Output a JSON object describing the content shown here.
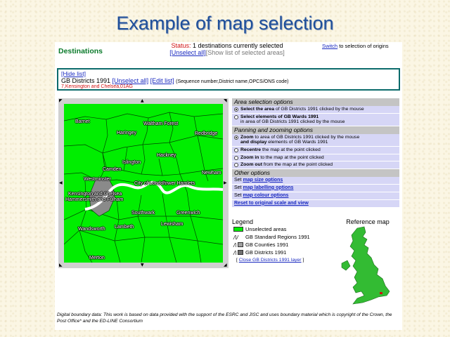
{
  "slide": {
    "title": "Example of map selection"
  },
  "header": {
    "destinations_label": "Destinations",
    "status_label": "Status:",
    "status_text": "1 destinations currently selected",
    "unselect_all": "[Unselect all]",
    "show_list": "[Show list of selected areas]",
    "switch_link": "Switch",
    "switch_text": "to selection of origins"
  },
  "selection": {
    "hide_list": "[Hide list]",
    "layer_name": "GB Districts 1991",
    "unselect_all": "[Unselect all]",
    "edit_list": "[Edit list]",
    "format_hint": "(Sequence number,District name,OPCS/ONS code)",
    "selected_item": "7,Kensington and Chelsea,01AG"
  },
  "map": {
    "labels": [
      "Barnet",
      "Waltham Forest",
      "Haringey",
      "Redbridge",
      "Hackney",
      "Islington",
      "Camden",
      "Newham",
      "Westminster",
      "Tower Hamlets",
      "City of London",
      "Kensington and Chelsea",
      "Hammersmith and Fulham",
      "Southwark",
      "Greenwich",
      "Wandsworth",
      "Lambeth",
      "Lewisham",
      "Merton"
    ],
    "colors": {
      "land": "#00ee00",
      "selected": "#8a8a8a",
      "river": "#ffffff"
    }
  },
  "options": {
    "area_header": "Area selection options",
    "area_opt1_a": "Select the area",
    "area_opt1_b": "of GB Districts 1991 clicked by the mouse",
    "area_opt2_a": "Select elements of GB Wards 1991",
    "area_opt2_b": "in area of GB Districts 1991 clicked by the mouse",
    "pan_header": "Panning and zooming options",
    "pan_opt1_a": "Zoom",
    "pan_opt1_b": "to area of GB Districts 1991 clicked by the mouse",
    "pan_opt1_c": "and display",
    "pan_opt1_d": "elements of GB Wards 1991",
    "pan_opt2_a": "Recentre",
    "pan_opt2_b": "the map at the point clicked",
    "pan_opt3_a": "Zoom in",
    "pan_opt3_b": "to the map at the point clicked",
    "pan_opt4_a": "Zoom out",
    "pan_opt4_b": "from the map at the point clicked",
    "other_header": "Other options",
    "set_label": "Set",
    "map_size": "map size options",
    "map_labelling": "map labelling options",
    "map_colour": "map colour options",
    "reset": "Reset to original scale and view"
  },
  "legend": {
    "title": "Legend",
    "unselected": "Unselected areas",
    "regions": "GB Standard Regions 1991",
    "counties": "GB Counties 1991",
    "districts": "GB Districts 1991",
    "close_layer": "Close GB Districts 1991 layer",
    "colors": {
      "unselected": "#00ee00",
      "counties": "#a0a0a0",
      "districts": "#707070"
    }
  },
  "reference_map": {
    "title": "Reference map",
    "colors": {
      "land": "#33bb33",
      "marker": "#d01010"
    }
  },
  "footnote": "Digital boundary data: This work is based on data provided with the support of the ESRC and JISC and uses boundary material which is copyright of the Crown, the Post Office* and the ED-LINE Consortium"
}
